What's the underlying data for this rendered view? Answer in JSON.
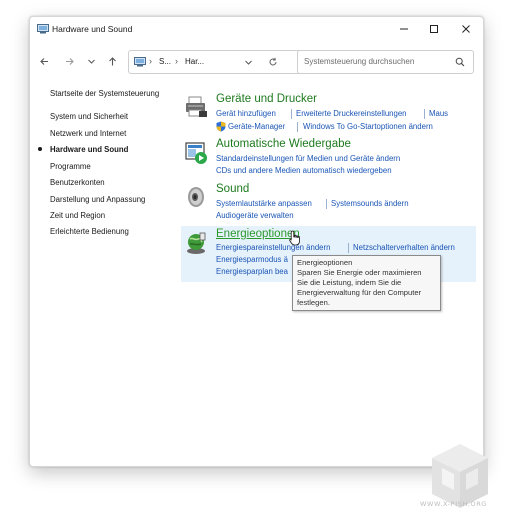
{
  "window": {
    "title": "Hardware und Sound"
  },
  "address": {
    "crumbs": [
      "S...",
      "Har..."
    ],
    "search_placeholder": "Systemsteuerung durchsuchen"
  },
  "sidebar": {
    "items": [
      {
        "label": "Startseite der Systemsteuerung",
        "active": false
      },
      {
        "label": "System und Sicherheit",
        "active": false
      },
      {
        "label": "Netzwerk und Internet",
        "active": false
      },
      {
        "label": "Hardware und Sound",
        "active": true
      },
      {
        "label": "Programme",
        "active": false
      },
      {
        "label": "Benutzerkonten",
        "active": false
      },
      {
        "label": "Darstellung und Anpassung",
        "active": false
      },
      {
        "label": "Zeit und Region",
        "active": false
      },
      {
        "label": "Erleichterte Bedienung",
        "active": false
      }
    ]
  },
  "categories": {
    "devices": {
      "title": "Geräte und Drucker",
      "links": [
        "Gerät hinzufügen",
        "Erweiterte Druckereinstellungen",
        "Maus",
        "Geräte-Manager",
        "Windows To Go-Startoptionen ändern"
      ]
    },
    "autoplay": {
      "title": "Automatische Wiedergabe",
      "links": [
        "Standardeinstellungen für Medien und Geräte ändern",
        "CDs und andere Medien automatisch wiedergeben"
      ]
    },
    "sound": {
      "title": "Sound",
      "links": [
        "Systemlautstärke anpassen",
        "Systemsounds ändern",
        "Audiogeräte verwalten"
      ]
    },
    "power": {
      "title": "Energieoptionen",
      "links": [
        "Energiespareinstellungen ändern",
        "Netzschalterverhalten ändern",
        "Energiesparmodus ä",
        "Energiesparplan bea"
      ]
    }
  },
  "tooltip": {
    "lines": [
      "Energieoptionen",
      "Sparen Sie Energie oder maximieren",
      "Sie die Leistung, indem Sie die",
      "Energieverwaltung für den Computer",
      "festlegen."
    ]
  },
  "watermark": {
    "text": "WWW.X-PISH.ORG"
  },
  "colors": {
    "link": "#1a55b5",
    "category_title": "#1e7a1e",
    "highlight": "#e5f1fb"
  }
}
